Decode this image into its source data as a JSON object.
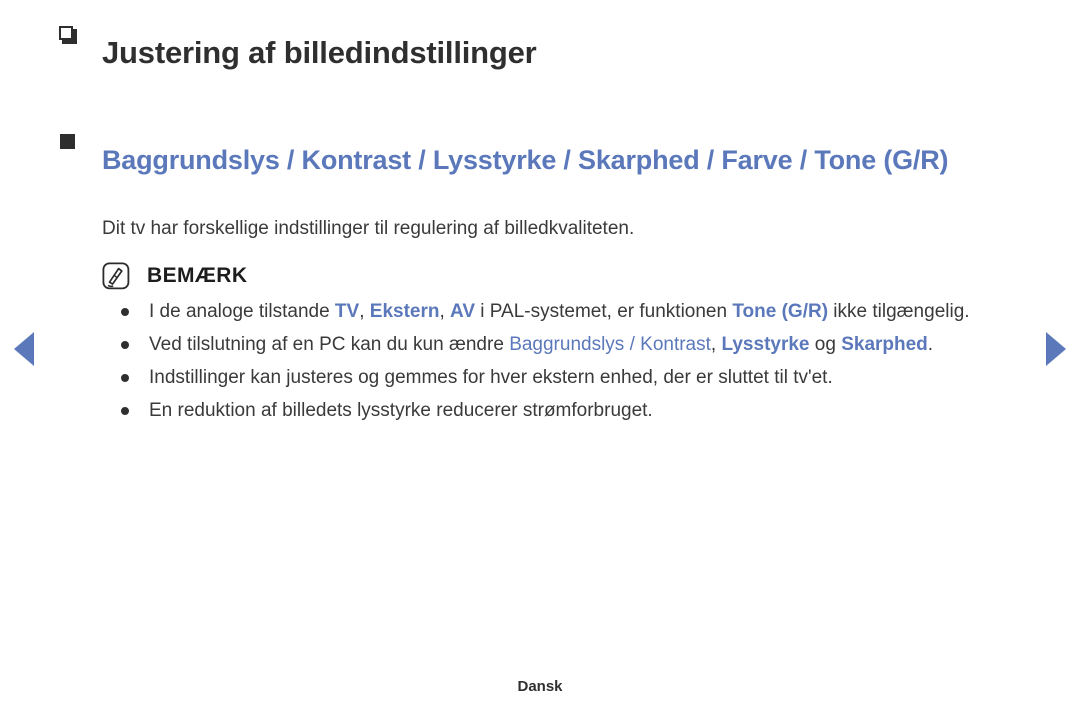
{
  "document": {
    "title": "Justering af billedindstillinger",
    "footer_label": "Dansk"
  },
  "section": {
    "heading": "Baggrundslys / Kontrast / Lysstyrke / Skarphed / Farve / Tone (G/R)",
    "heading_line1": "Baggrundslys / Kontrast / Lysstyrke / Skarphed / Farve / Tone",
    "heading_line2": "(G/R)",
    "lead_paragraph": "Dit tv har forskellige indstillinger til regulering af billedkvaliteten."
  },
  "note": {
    "icon_name": "note-pencil-icon",
    "label": "BEMÆRK",
    "items": [
      {
        "segments": [
          {
            "text": "I de analoge tilstande ",
            "style": "plain"
          },
          {
            "text": "TV",
            "style": "keyword"
          },
          {
            "text": ", ",
            "style": "plain"
          },
          {
            "text": "Ekstern",
            "style": "keyword"
          },
          {
            "text": ", ",
            "style": "plain"
          },
          {
            "text": "AV",
            "style": "keyword"
          },
          {
            "text": " i PAL-systemet, er funktionen ",
            "style": "plain"
          },
          {
            "text": "Tone (G/R)",
            "style": "keyword"
          },
          {
            "text": " ikke tilgængelig.",
            "style": "plain"
          }
        ]
      },
      {
        "segments": [
          {
            "text": "Ved tilslutning af en PC kan du kun ændre ",
            "style": "plain"
          },
          {
            "text": "Baggrundslys / Kontrast",
            "style": "keyword-regular"
          },
          {
            "text": ", ",
            "style": "plain"
          },
          {
            "text": "Lysstyrke",
            "style": "keyword"
          },
          {
            "text": " og ",
            "style": "plain"
          },
          {
            "text": "Skarphed",
            "style": "keyword"
          },
          {
            "text": ".",
            "style": "plain"
          }
        ]
      },
      {
        "segments": [
          {
            "text": "Indstillinger kan justeres og gemmes for hver ekstern enhed, der er sluttet til tv'et.",
            "style": "plain"
          }
        ]
      },
      {
        "segments": [
          {
            "text": "En reduktion af billedets lysstyrke reducerer strømforbruget.",
            "style": "plain"
          }
        ]
      }
    ]
  },
  "navigation": {
    "prev_icon": "triangle-left-icon",
    "next_icon": "triangle-right-icon",
    "prev_label": "",
    "next_label": ""
  },
  "colors": {
    "accent_blue": "#5b78bb",
    "text": "#3a3a3a",
    "heading_text": "#2f2f2f",
    "background": "#ffffff"
  }
}
